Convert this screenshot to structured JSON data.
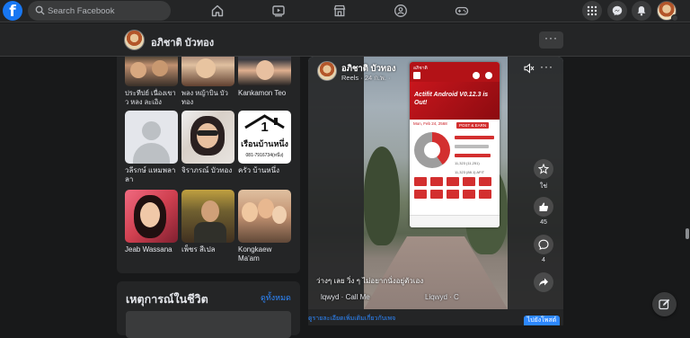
{
  "topbar": {
    "logo": "f",
    "search_placeholder": "Search Facebook",
    "nav_icons": [
      "home-icon",
      "watch-icon",
      "marketplace-icon",
      "groups-icon",
      "gaming-icon"
    ],
    "right_icons": [
      "menu-grid-icon",
      "messenger-icon",
      "bell-icon"
    ]
  },
  "profile": {
    "name": "อภิชาติ บัวทอง",
    "more_label": "···"
  },
  "friends": [
    {
      "name": "ประทีปย์ เนื่องเขาว หลง ละเอิง"
    },
    {
      "name": "พลง หญ้าบิน บัว ทอง"
    },
    {
      "name": "Kankamon Teo"
    },
    {
      "name": "วลีรกษ์ แหมพลาลา"
    },
    {
      "name": "จิราภรณ์ บัวทอง"
    },
    {
      "name": "ครัว บ้านหนึ่ง"
    },
    {
      "name": "Jeab Wassana"
    },
    {
      "name": "เพ็ชร สีเปล"
    },
    {
      "name": "Kongkaew Ma'am"
    }
  ],
  "friend_pic_texts": {
    "house_big": "1",
    "house_line": "เรือนบ้านหนึ่ง",
    "house_phone": "081-7916734(หนึ่ง)"
  },
  "life_events": {
    "title": "เหตุการณ์ในชีวิต",
    "see_all": "ดูทั้งหมด"
  },
  "post": {
    "author": "อภิชาติ บัวทอง",
    "meta": "Reels · 24 ก.พ. ·",
    "more": "···",
    "caption": "ว่างๆ เลย วิ่ง ๆ ไม่อยากนั่งอยู่ตัวเอง",
    "music_left": "lqwyd · Call Me",
    "music_right": "Liqwyd · C",
    "phone": {
      "user": "อภิชาติ",
      "banner": "Actifit Android V0.12.3 is Out!",
      "date": "Mon, Feb 24, 2568",
      "post_earn": "POST & EARN",
      "steps": "11,323 (11,251)",
      "afit": "11,323 (88.1) AFIT"
    },
    "actions": [
      {
        "icon": "reel-star-icon",
        "label": "ใช่"
      },
      {
        "icon": "like-icon",
        "label": "45"
      },
      {
        "icon": "comment-icon",
        "label": "4"
      },
      {
        "icon": "share-icon",
        "label": ""
      }
    ],
    "footer_link": "ดูรายละเอียดเพิ่มเติมเกี่ยวกับเพจ",
    "footer_button": "ไปยังโพสต์"
  }
}
